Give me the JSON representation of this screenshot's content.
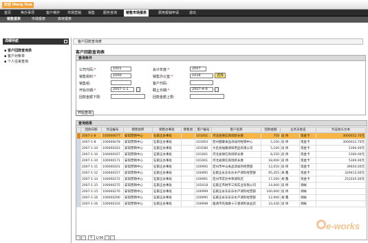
{
  "header": {
    "welcome": "欢迎 Wang Hua"
  },
  "topnav": [
    "首页",
    "等办事项",
    "客户维护",
    "市场营销",
    "销售",
    "服务咨询",
    "销售市场报表",
    "费用报销申请",
    "退出"
  ],
  "subnav": [
    "销售报表",
    "市场报表",
    "库存报表"
  ],
  "sidebar": {
    "title": "详细导航",
    "items": [
      "客户回款查询表",
      "客户对帐单",
      "个人往来查询"
    ]
  },
  "page": {
    "bar_title": "客户回款查询表",
    "title": "客户回款查询表",
    "criteria_header": "查询条件",
    "query_button": "开始查询"
  },
  "form": {
    "company_code": {
      "label": "公司代码:",
      "value": "1001"
    },
    "fiscal_year": {
      "label": "会计年度:",
      "value": "2007"
    },
    "sales_org": {
      "label": "销售组织:",
      "value": "1000"
    },
    "sales_office": {
      "label": "销售办公室:",
      "value": "1016",
      "button": "选择"
    },
    "sales_group": {
      "label": "销售组:",
      "value": ""
    },
    "customer_code": {
      "label": "客户代码:",
      "value": ""
    },
    "start_date": {
      "label": "开始日期:",
      "value": "2007-1-1"
    },
    "end_date": {
      "label": "截止日期:",
      "value": "2007-4-9"
    },
    "amount_min": {
      "label": "回款金额下限:",
      "value": ""
    },
    "amount_max": {
      "label": "回款金额上限:",
      "value": ""
    }
  },
  "results": {
    "header": "查询结果",
    "columns": [
      "回款日期",
      "凭证编号",
      "销售组织",
      "销售办事处",
      "销售组",
      "客户编号",
      "客户名称",
      "回款金额",
      "业务员姓名",
      "凭证抬头文本"
    ],
    "rows": [
      [
        "2007-1-8",
        "100000077",
        "安琪营销中心",
        "石家庄办事处",
        "",
        "101001",
        "河北省保信商场新长春",
        "750",
        "段 炜",
        "现金卡",
        "3000012.70元"
      ],
      [
        "2007-1-8",
        "100000078",
        "安琪营销中心",
        "石家庄办事处",
        "",
        "101003",
        "晋州健康食品添加剂经销中心",
        "5,100",
        "段 炜",
        "现金卡",
        "3000012.70元"
      ],
      [
        "2007-1-10",
        "100000163",
        "安琪营销中心",
        "石家庄办事处",
        "",
        "103580",
        "大名县福康调味用品有限公司",
        "5,100",
        "段 炜",
        "现金卡",
        "5300.00元"
      ],
      [
        "2007-1-10",
        "100000167",
        "安琪营销中心",
        "石家庄办事处",
        "",
        "101001",
        "河北省保信商场新长春",
        "8,250",
        "段 炜",
        "现金卡",
        "5300.00元"
      ],
      [
        "2007-1-10",
        "100000171",
        "安琪营销中心",
        "石家庄办事处",
        "",
        "101001",
        "河北省保信商场新长春",
        "18,000",
        "段 炜",
        "现金卡",
        "5300.00元"
      ],
      [
        "2007-1-11",
        "100000201",
        "安琪营销中心",
        "石家庄办事处",
        "",
        "100992",
        "定州市中山食品添加剂经营部",
        "12,650",
        "段 炜",
        "现金卡",
        "39650.00元"
      ],
      [
        "2007-1-12",
        "100000257",
        "安琪营销中心",
        "石家庄办事处",
        "",
        "100995",
        "石家庄永东乐乐水产调料经营部",
        "95,455",
        "胡 鑫",
        "现金卡",
        "329413.00元"
      ],
      [
        "2007-1-14",
        "100000272",
        "安琪营销中心",
        "石家庄办事处",
        "",
        "100991",
        "定州市宏达中草调料店",
        "17,200",
        "胡 鑫",
        "现金卡",
        "251035.00元"
      ],
      [
        "2007-1-15",
        "100000275",
        "安琪营销中心",
        "石家庄办事处",
        "",
        "105018",
        "石家庄市财宇三阳实业有限公司",
        "14,000",
        "段 炜",
        "调帐",
        ""
      ],
      [
        "2007-1-15",
        "100000276",
        "安琪营销中心",
        "石家庄办事处",
        "",
        "100999",
        "石家庄永东乐乐水产调料经营部",
        "100,000",
        "段 炜",
        "调帐",
        ""
      ],
      [
        "2007-1-16",
        "100000290",
        "安琪营销中心",
        "石家庄办事处",
        "",
        "100995",
        "石家庄永东乐乐水产调料经营部",
        "12,900",
        "胡 鑫",
        "调帐",
        ""
      ],
      [
        "2007-1-16",
        "100000316",
        "安琪营销中心",
        "石家庄办事处",
        "",
        "100998",
        "临清市先锋路十三香调料食品店",
        "33,430",
        "段 炜",
        "调帐",
        ""
      ]
    ]
  },
  "pager": {
    "page": "1",
    "total": "1/36"
  },
  "watermark": "e-works"
}
